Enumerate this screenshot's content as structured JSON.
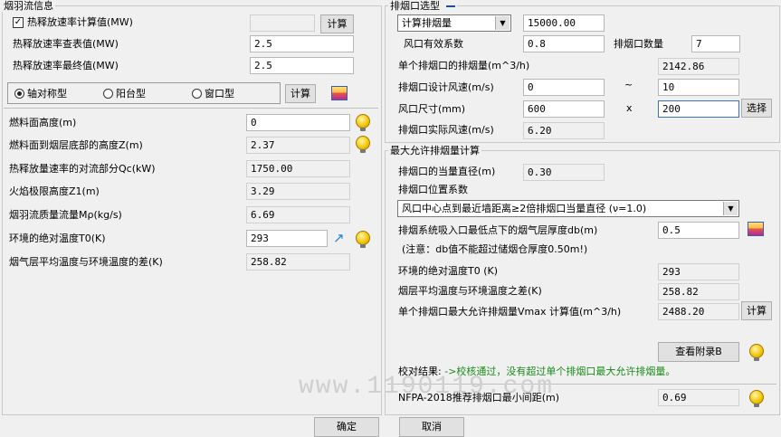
{
  "left": {
    "group_title": "烟羽流信息",
    "hrr_checkbox_label": "热释放速率计算值(MW)",
    "hrr_calc_value": "",
    "calc_btn_1": "计算",
    "hrr_table_label": "热释放速率查表值(MW)",
    "hrr_table_value": "2.5",
    "hrr_final_label": "热释放速率最终值(MW)",
    "hrr_final_value": "2.5",
    "radio_axis": "轴对称型",
    "radio_balcony": "阳台型",
    "radio_window": "窗口型",
    "calc_btn_2": "计算",
    "fuel_height_label": "燃料面高度(m)",
    "fuel_height_value": "0",
    "fuel_to_smoke_label": "燃料面到烟层底部的高度Z(m)",
    "fuel_to_smoke_value": "2.37",
    "convective_label": "热释放量速率的对流部分Qc(kW)",
    "convective_value": "1750.00",
    "flame_label": "火焰极限高度Z1(m)",
    "flame_value": "3.29",
    "mass_flow_label": "烟羽流质量流量Mρ(kg/s)",
    "mass_flow_value": "6.69",
    "ambient_label": "环境的绝对温度T0(K)",
    "ambient_value": "293",
    "diff_label": "烟气层平均温度与环境温度的差(K)",
    "diff_value": "258.82"
  },
  "right_top": {
    "group_title": "排烟口选型",
    "mode_select": "计算排烟量",
    "mode_value": "15000.00",
    "coef_label": "风口有效系数",
    "coef_value": "0.8",
    "count_label": "排烟口数量",
    "count_value": "7",
    "single_label": "单个排烟口的排烟量(m^3/h)",
    "single_value": "2142.86",
    "speed_label": "排烟口设计风速(m/s)",
    "speed_min": "0",
    "tilde": "~",
    "speed_max": "10",
    "size_label": "风口尺寸(mm)",
    "size_w": "600",
    "times": "x",
    "size_h": "200",
    "select_btn": "选择",
    "actual_label": "排烟口实际风速(m/s)",
    "actual_value": "6.20"
  },
  "right_bottom": {
    "group_title": "最大允许排烟量计算",
    "eq_diam_label": "排烟口的当量直径(m)",
    "eq_diam_value": "0.30",
    "pos_coef_label": "排烟口位置系数",
    "pos_select": "风口中心点到最近墙距离≥2倍排烟口当量直径 (ν=1.0)",
    "thick_label": "排烟系统吸入口最低点下的烟气层厚度db(m)",
    "thick_value": "0.5",
    "note": "(注意：db值不能超过储烟仓厚度0.50m!)",
    "ambient_label": "环境的绝对温度T0 (K)",
    "ambient_value": "293",
    "diff_label": "烟层平均温度与环境温度之差(K)",
    "diff_value": "258.82",
    "vmax_label": "单个排烟口最大允许排烟量Vmax 计算值(m^3/h)",
    "vmax_value": "2488.20",
    "calc_btn": "计算",
    "appendix_btn": "查看附录B",
    "result_label": "校对结果:",
    "result_text": "->校核通过，没有超过单个排烟口最大允许排烟量。",
    "nfpa_label": "NFPA-2018推荐排烟口最小间距(m)",
    "nfpa_value": "0.69"
  },
  "footer": {
    "ok_btn": "确定",
    "cancel_btn": "取消"
  },
  "watermark": "www.1190119.com",
  "colors": {
    "accent_blue": "#1f4ea0",
    "result_green": "#1a8a1a"
  }
}
